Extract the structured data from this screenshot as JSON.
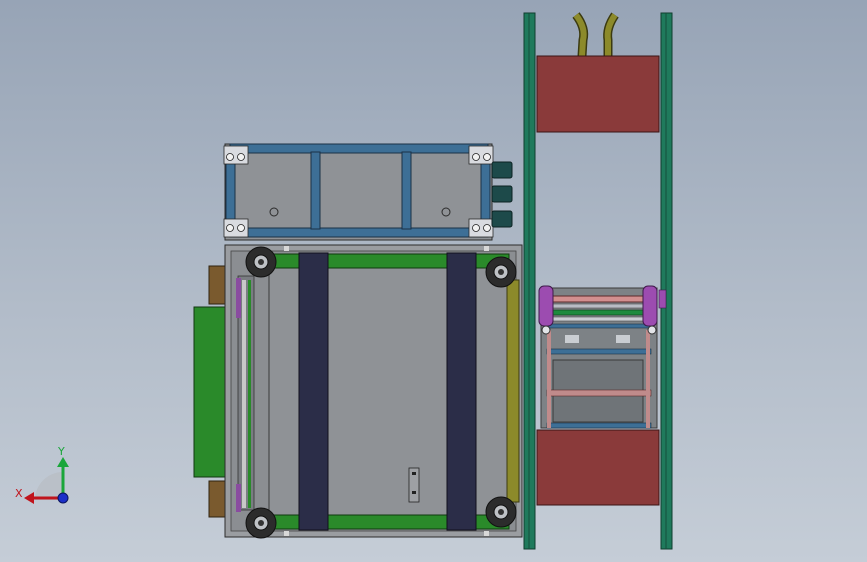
{
  "viewport": {
    "background_top": "#97a4b6",
    "background_bottom": "#c5cdd7"
  },
  "triad": {
    "x_label": "X",
    "y_label": "Y",
    "x_color": "#c0141c",
    "y_color": "#1aa63a",
    "z_color": "#1b2fc9"
  },
  "colors": {
    "frame_green": "#1f7a5c",
    "conveyor_green": "#2a8a2a",
    "belt_dark": "#2b2d48",
    "motor_red": "#8a3a3a",
    "panel_gray": "#8f9296",
    "beam_blue": "#3d6f96",
    "wheel_dark": "#2c2c2c",
    "bracket_purple": "#8a4ca0",
    "cable_olive": "#8c8a2a",
    "bracket_brown": "#7a5a2e"
  }
}
